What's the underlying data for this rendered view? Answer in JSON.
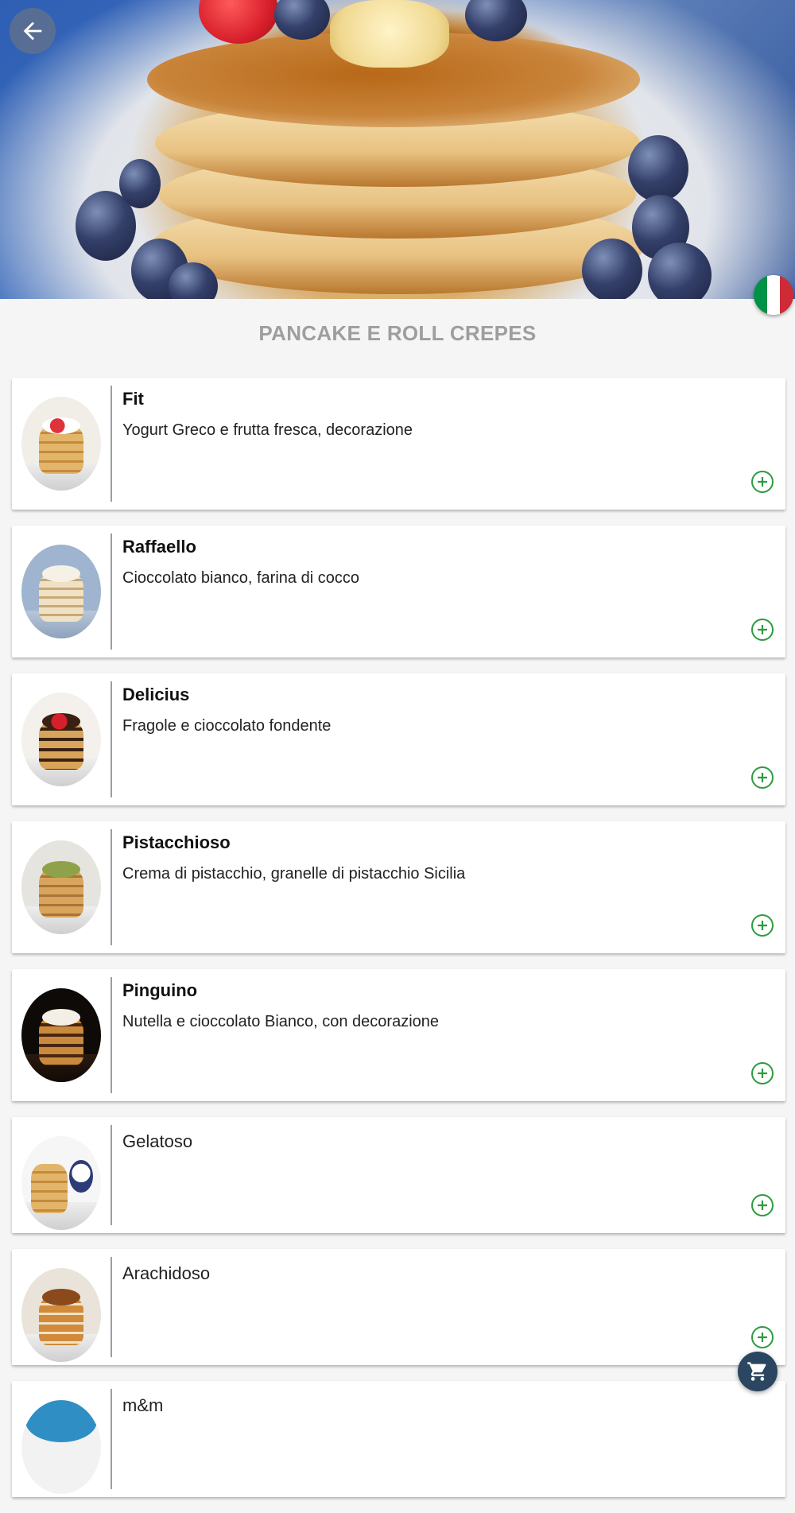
{
  "hero": {
    "image": "pancake-stack-with-blueberries",
    "back_icon": "arrow-left-icon"
  },
  "language": {
    "flag": "italy-flag-icon",
    "colors": [
      "#009246",
      "#ffffff",
      "#ce2b37"
    ]
  },
  "category": {
    "title": "PANCAKE E ROLL CREPES"
  },
  "items": [
    {
      "name": "Fit",
      "description": "Yogurt Greco e frutta fresca, decorazione",
      "thumb": "pancake-fruit-yogurt"
    },
    {
      "name": "Raffaello",
      "description": "Cioccolato bianco, farina di cocco",
      "thumb": "pancake-coconut"
    },
    {
      "name": "Delicius",
      "description": "Fragole e cioccolato fondente",
      "thumb": "pancake-strawberry-chocolate"
    },
    {
      "name": "Pistacchioso",
      "description": "Crema di pistacchio, granelle di pistacchio Sicilia",
      "thumb": "pancake-pistachio"
    },
    {
      "name": "Pinguino",
      "description": "Nutella e cioccolato Bianco, con decorazione",
      "thumb": "pancake-nutella"
    },
    {
      "name": "Gelatoso",
      "description": "",
      "thumb": "pancake-gelato"
    },
    {
      "name": "Arachidoso",
      "description": "",
      "thumb": "pancake-peanut"
    },
    {
      "name": "m&m",
      "description": "",
      "thumb": "pancake-mm"
    }
  ],
  "icons": {
    "add": "plus-circle-icon",
    "cart": "shopping-cart-icon"
  },
  "theme": {
    "accent_green": "#2e9b3f",
    "fab_background": "#2b4660",
    "title_gray": "#9e9e9e"
  }
}
